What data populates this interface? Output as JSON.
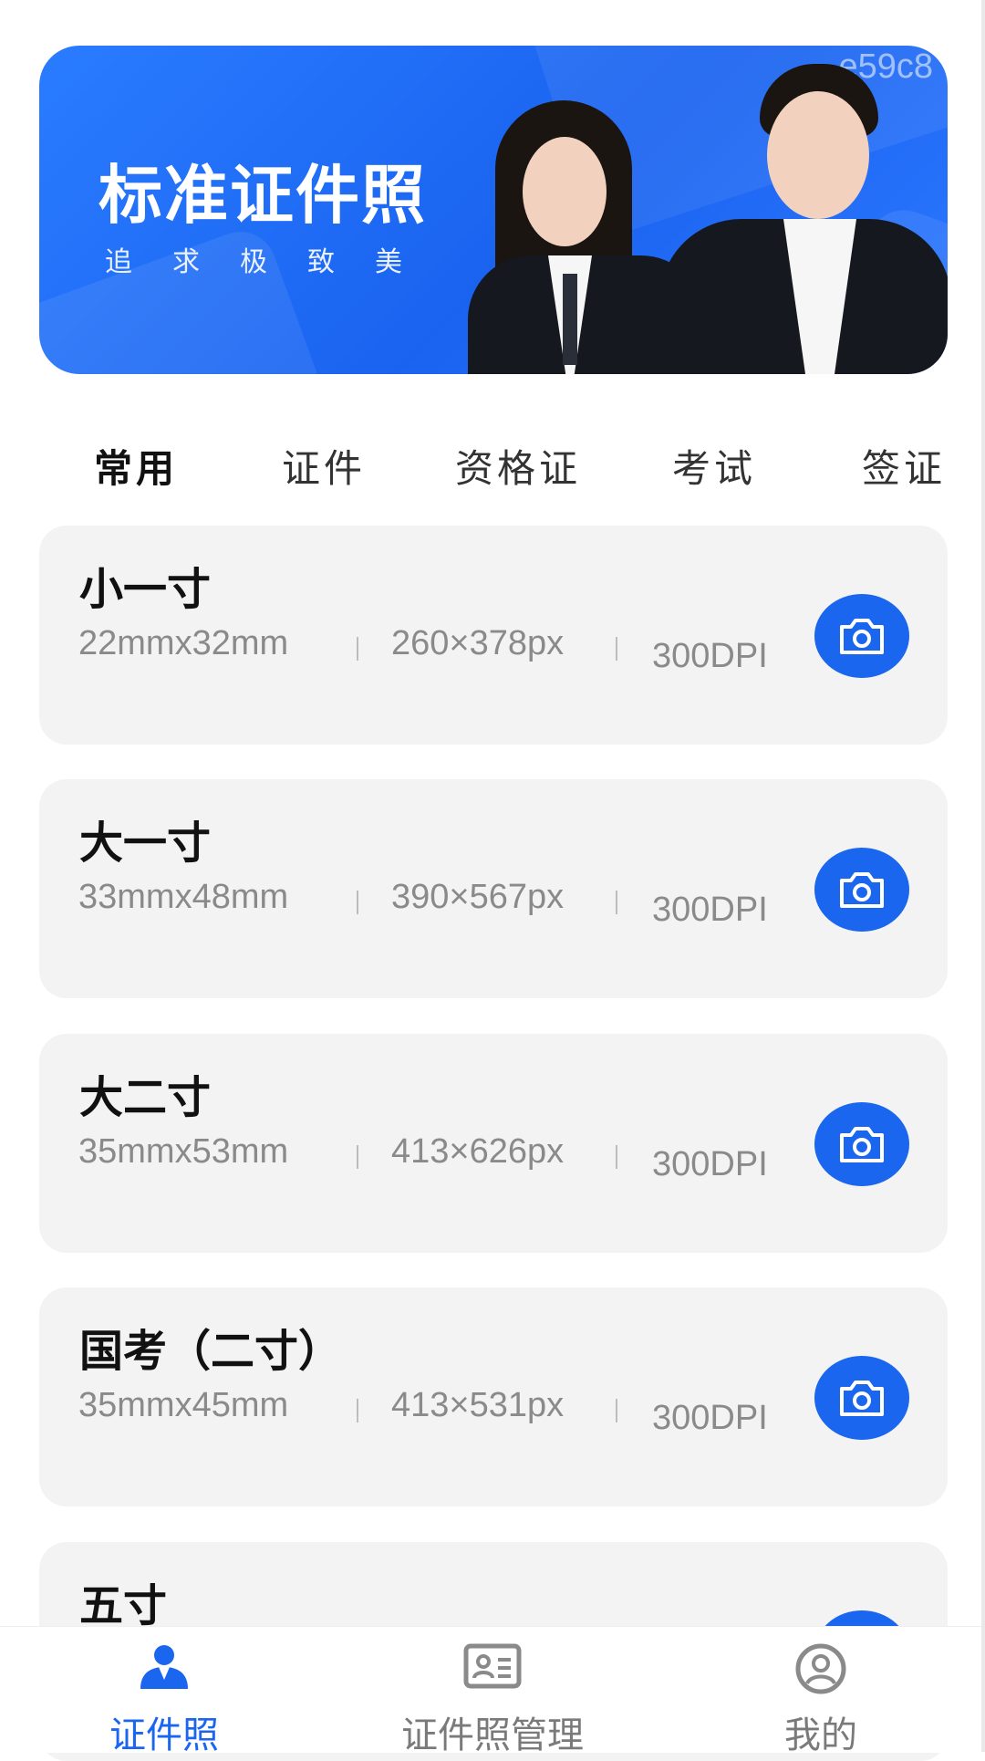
{
  "banner": {
    "title": "标准证件照",
    "subtitle": "追求极致美",
    "code": "e59c8"
  },
  "tabs": [
    {
      "label": "常用",
      "active": true
    },
    {
      "label": "证件",
      "active": false
    },
    {
      "label": "资格证",
      "active": false
    },
    {
      "label": "考试",
      "active": false
    },
    {
      "label": "签证",
      "active": false
    }
  ],
  "cards": [
    {
      "title": "小一寸",
      "size_mm": "22mmx32mm",
      "size_px": "260×378px",
      "dpi": "300DPI"
    },
    {
      "title": "大一寸",
      "size_mm": "33mmx48mm",
      "size_px": "390×567px",
      "dpi": "300DPI"
    },
    {
      "title": "大二寸",
      "size_mm": "35mmx53mm",
      "size_px": "413×626px",
      "dpi": "300DPI"
    },
    {
      "title": "国考（二寸）",
      "size_mm": "35mmx45mm",
      "size_px": "413×531px",
      "dpi": "300DPI"
    },
    {
      "title": "五寸",
      "size_mm": "",
      "size_px": "",
      "dpi": ""
    }
  ],
  "nav": [
    {
      "label": "证件照",
      "icon": "id-photo-icon",
      "active": true
    },
    {
      "label": "证件照管理",
      "icon": "id-card-icon",
      "active": false
    },
    {
      "label": "我的",
      "icon": "profile-icon",
      "active": false
    }
  ],
  "colors": {
    "primary": "#1a66ee",
    "card_bg": "#f3f3f3",
    "muted_text": "#8a8a8a"
  }
}
